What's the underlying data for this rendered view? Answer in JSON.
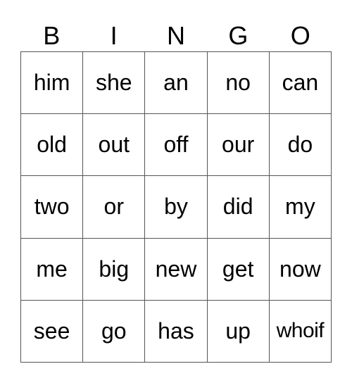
{
  "header": [
    "B",
    "I",
    "N",
    "G",
    "O"
  ],
  "rows": [
    [
      "him",
      "she",
      "an",
      "no",
      "can"
    ],
    [
      "old",
      "out",
      "off",
      "our",
      "do"
    ],
    [
      "two",
      "or",
      "by",
      "did",
      "my"
    ],
    [
      "me",
      "big",
      "new",
      "get",
      "now"
    ],
    [
      "see",
      "go",
      "has",
      "up",
      "whoif"
    ]
  ]
}
